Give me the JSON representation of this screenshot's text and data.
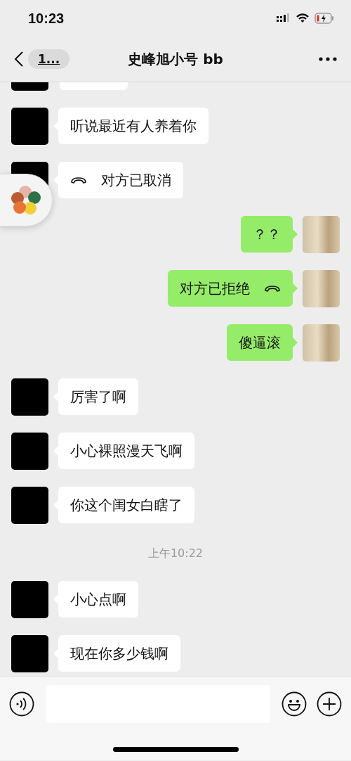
{
  "status_bar": {
    "time": "10:23"
  },
  "header": {
    "back_badge": "1...",
    "title": "史峰旭小号 bb"
  },
  "messages": [
    {
      "outgoing": false,
      "kind": "clipped"
    },
    {
      "outgoing": false,
      "kind": "text",
      "text": "听说最近有人养着你"
    },
    {
      "outgoing": false,
      "kind": "call",
      "text": "对方已取消"
    },
    {
      "outgoing": true,
      "kind": "text",
      "text": "？？"
    },
    {
      "outgoing": true,
      "kind": "call",
      "text": "对方已拒绝"
    },
    {
      "outgoing": true,
      "kind": "text",
      "text": "傻逼滚"
    },
    {
      "outgoing": false,
      "kind": "text",
      "text": "厉害了啊"
    },
    {
      "outgoing": false,
      "kind": "text",
      "text": "小心裸照漫天飞啊"
    },
    {
      "outgoing": false,
      "kind": "text",
      "text": "你这个闺女白瞎了"
    },
    {
      "kind": "time",
      "text": "上午10:22"
    },
    {
      "outgoing": false,
      "kind": "text",
      "text": "小心点啊"
    },
    {
      "outgoing": false,
      "kind": "text",
      "text": "现在你多少钱啊"
    }
  ]
}
